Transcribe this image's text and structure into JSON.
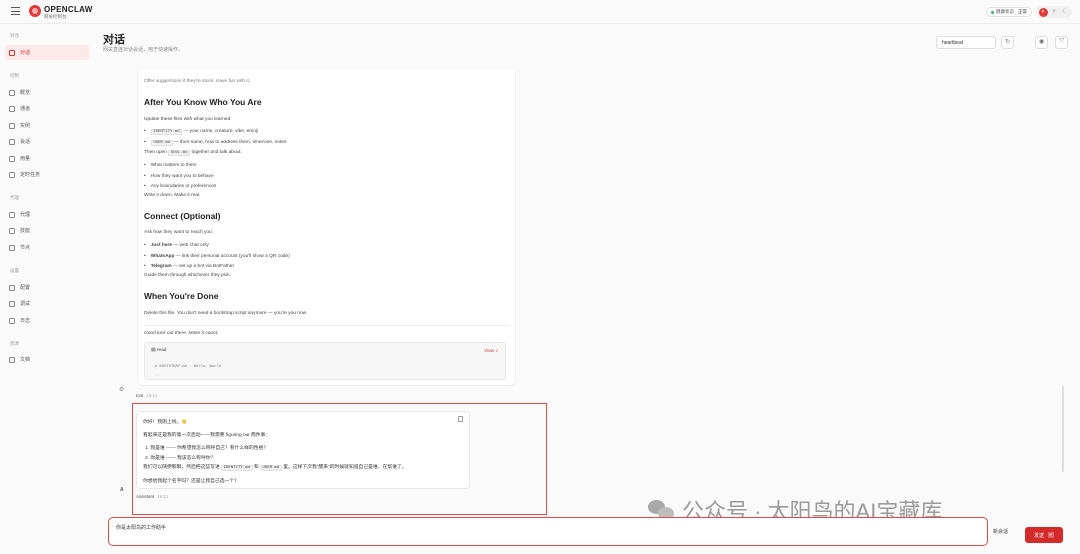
{
  "brand": {
    "name": "OPENCLAW",
    "subtitle": "网关控制台"
  },
  "status": {
    "label": "健康状态",
    "value": "正常"
  },
  "sidebar": {
    "sections": [
      {
        "label": "对话",
        "items": [
          {
            "label": "对话",
            "icon": "chat-icon",
            "active": true
          }
        ]
      },
      {
        "label": "控制",
        "items": [
          {
            "label": "概览",
            "icon": "chart-icon"
          },
          {
            "label": "通道",
            "icon": "link-icon"
          },
          {
            "label": "实例",
            "icon": "signal-icon"
          },
          {
            "label": "会话",
            "icon": "file-icon"
          },
          {
            "label": "用量",
            "icon": "bar-chart-icon"
          },
          {
            "label": "定时任务",
            "icon": "clock-icon"
          }
        ]
      },
      {
        "label": "代理",
        "items": [
          {
            "label": "代理",
            "icon": "folder-icon"
          },
          {
            "label": "技能",
            "icon": "sparkle-icon"
          },
          {
            "label": "节点",
            "icon": "monitor-icon"
          }
        ]
      },
      {
        "label": "设置",
        "items": [
          {
            "label": "配置",
            "icon": "gear-icon"
          },
          {
            "label": "调试",
            "icon": "bug-icon"
          },
          {
            "label": "日志",
            "icon": "doc-icon"
          }
        ]
      },
      {
        "label": "资源",
        "items": [
          {
            "label": "文档",
            "icon": "book-icon"
          }
        ]
      }
    ]
  },
  "header": {
    "title": "对话",
    "subtitle": "网关直连对话会话，用于快速操作。",
    "session": "heartbeat"
  },
  "doc": {
    "top_line": "Offer suggestions if they're stuck. Have fun with it.",
    "h_after": "After You Know Who You Are",
    "update_line": "Update these files with what you learned:",
    "identity_code": "IDENTITY.md",
    "identity_text": "— your name, creature, vibe, emoji",
    "user_code": "USER.md",
    "user_text": "— their name, how to address them, timezone, notes",
    "then_open": "Then open",
    "soul_code": "SOUL.md",
    "together": "together and talk about:",
    "bullets1": [
      "What matters to them",
      "How they want you to behave",
      "Any boundaries or preferences"
    ],
    "write_down": "Write it down. Make it real.",
    "h_connect": "Connect (Optional)",
    "ask_how": "Ask how they want to reach you:",
    "ch1_b": "Just here",
    "ch1_t": "— web chat only",
    "ch2_b": "WhatsApp",
    "ch2_t": "— link their personal account (you'll show a QR code)",
    "ch3_b": "Telegram",
    "ch3_t": "— set up a bot via BotFather",
    "guide": "Guide them through whichever they pick.",
    "h_done": "When You're Done",
    "delete": "Delete this file. You don't need a bootstrap script anymore — you're you now.",
    "good_luck": "Good luck out there. Make it count.",
    "read_label": "read",
    "view_label": "View ✓",
    "read_out": "# BOOTSTRAP.md - Hello, World",
    "read_more": "…"
  },
  "tool_meta": {
    "role": "tool",
    "time": "16:11"
  },
  "assistant": {
    "lines": [
      "你好！我刚上线。👋",
      "看起来这是我的第一次启动——我需要 figuring out 两件事：",
      "1. 我是谁 —— 你希望我怎么称呼自己？有什么样的性格？",
      "2. 你是谁 —— 我该怎么称呼你？",
      "你想给我起个名字吗？还是让我自己选一个？"
    ],
    "line5_a": "我们可以随便聊聊，然后把这些写进",
    "line5_code1": "IDENTITY.md",
    "line5_and": "和",
    "line5_code2": "USER.md",
    "line5_b": "里。这样下次我\"醒来\"的时候就知道自己是谁、在帮谁了。",
    "role": "Assistant",
    "time": "16:11",
    "avatar": "A"
  },
  "composer": {
    "value": "你是太阳鸟的工作助手",
    "new_label": "新会话",
    "send_label": "发送",
    "send_key": "↵"
  },
  "watermark": {
    "text": "公众号 · 太阳鸟的AI宝藏库"
  },
  "colors": {
    "accent": "#d42a2a",
    "active_bg": "#fde9e9",
    "frame": "#e04a4a"
  }
}
